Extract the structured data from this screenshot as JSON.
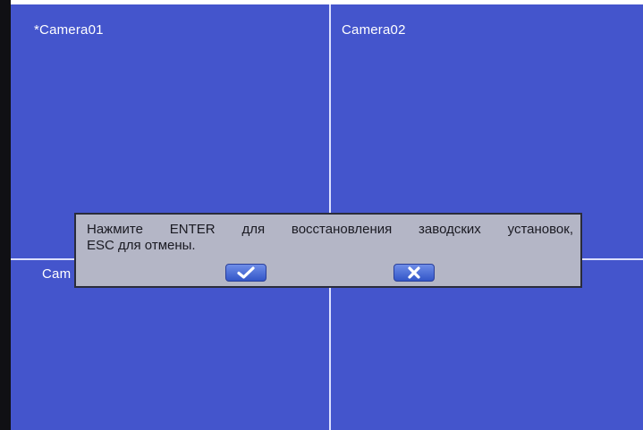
{
  "cameras": [
    {
      "label": "*Camera01"
    },
    {
      "label": "Camera02"
    },
    {
      "label": "Cam"
    }
  ],
  "dialog": {
    "line1": "Нажмите ENTER для восстановления заводских установок,",
    "line2": "ESC для отмены.",
    "confirm_icon": "checkmark-icon",
    "cancel_icon": "x-icon"
  },
  "colors": {
    "video_background": "#4455cc",
    "divider": "#dde0ff",
    "dialog_background": "#b4b6c6",
    "button": "#3f63d6"
  }
}
